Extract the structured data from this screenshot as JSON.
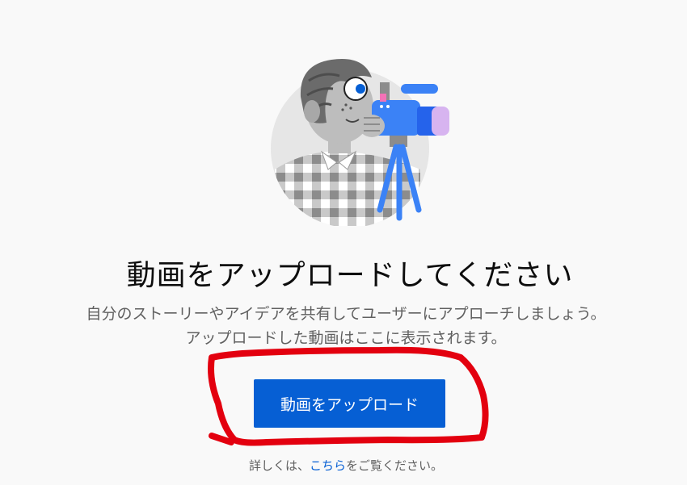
{
  "empty_state": {
    "title": "動画をアップロードしてください",
    "description_line1": "自分のストーリーやアイデアを共有してユーザーにアプローチしましょう。",
    "description_line2": "アップロードした動画はここに表示されます。",
    "upload_button_label": "動画をアップロード",
    "illustration_icon": "person-with-video-camera-icon"
  },
  "footer": {
    "prefix": "詳しくは、",
    "link_label": "こちら",
    "suffix": "をご覧ください。"
  },
  "colors": {
    "accent": "#065fd4",
    "title_text": "#0d0d0d",
    "secondary_text": "#606060",
    "annotation": "#e3000f",
    "background": "#f9f9f9"
  }
}
